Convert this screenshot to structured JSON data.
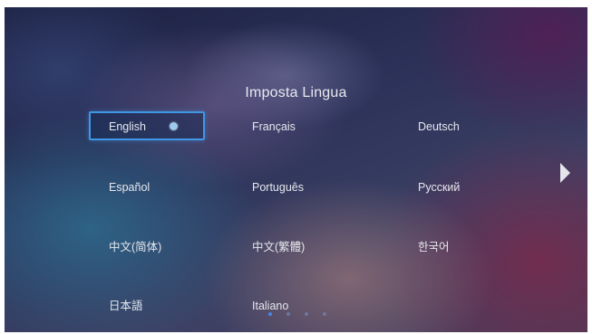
{
  "title": "Imposta Lingua",
  "languages": [
    {
      "label": "English",
      "selected": true
    },
    {
      "label": "Français"
    },
    {
      "label": "Deutsch"
    },
    {
      "label": "Español"
    },
    {
      "label": "Português"
    },
    {
      "label": "Русский"
    },
    {
      "label": "中文(简体)"
    },
    {
      "label": "中文(繁體)"
    },
    {
      "label": "한국어"
    },
    {
      "label": "日本語"
    },
    {
      "label": "Italiano"
    }
  ],
  "icons": {
    "next": "chevron-right-icon",
    "selected_marker": "radio-dot-icon"
  },
  "pagination": {
    "current": 1,
    "total": 4
  },
  "colors": {
    "accent": "#3f97e6",
    "text": "#e6e8ee",
    "active_page_dot": "#4b86e8"
  }
}
